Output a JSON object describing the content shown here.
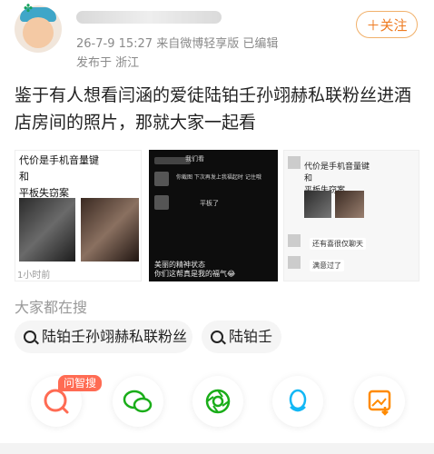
{
  "header": {
    "date_line": "26-7-9 15:27  来自微博轻享版  已编辑",
    "location_line": "发布于 浙江",
    "follow_label": "＋关注"
  },
  "post": {
    "text": "鉴于有人想看闫涵的爱徒陆铂壬孙翊赫私联粉丝进酒店房间的照片，那就大家一起看"
  },
  "images": {
    "img1": {
      "caption_line1": "代价是手机音量键",
      "caption_line2": "和",
      "caption_line3": "平板失窃案",
      "time": "1小时前"
    },
    "img2": {
      "chat1": "我们看",
      "chat2": "你截图 下次再发上我福起时 记住哦",
      "chat3": "平板了",
      "caption1": "美丽的精神状态",
      "caption2": "你们这帮真是我的福气😂"
    },
    "img3": {
      "caption_line1": "代价是手机音量键",
      "caption_line2": "和",
      "caption_line3": "平板失窃案",
      "msg1": "还有喜很仅聊天",
      "msg2": "满意过了"
    }
  },
  "search": {
    "heading": "大家都在搜",
    "chips": [
      "陆铂壬孙翊赫私联粉丝",
      "陆铂壬"
    ]
  },
  "share": {
    "badge": "问智搜",
    "icons": [
      "wenzhisou-icon",
      "wechat-icon",
      "moments-icon",
      "qq-icon",
      "save-image-icon"
    ],
    "colors": {
      "accent": "#ff6b53",
      "wechat": "#1aad19",
      "moments": "#1aad19",
      "qq": "#12b7f5",
      "save": "#ff8a00"
    }
  }
}
